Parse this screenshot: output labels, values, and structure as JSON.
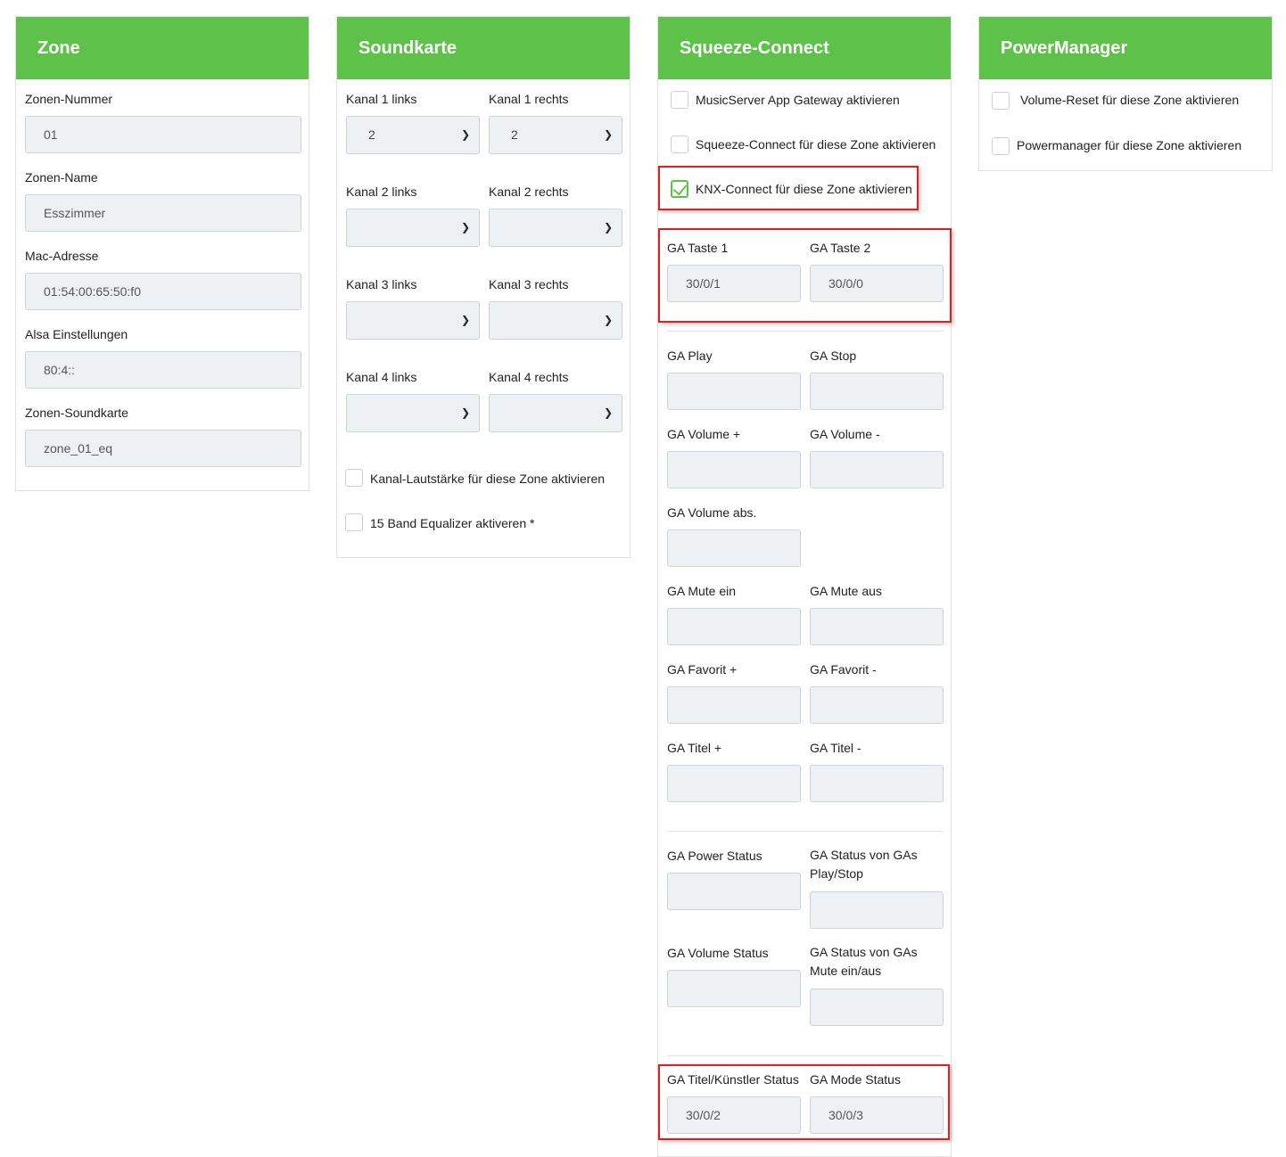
{
  "zone": {
    "title": "Zone",
    "fields": [
      {
        "label": "Zonen-Nummer",
        "value": "01"
      },
      {
        "label": "Zonen-Name",
        "value": "Esszimmer"
      },
      {
        "label": "Mac-Adresse",
        "value": "01:54:00:65:50:f0"
      },
      {
        "label": "Alsa Einstellungen",
        "value": "80:4::"
      },
      {
        "label": "Zonen-Soundkarte",
        "value": "zone_01_eq"
      }
    ]
  },
  "soundkarte": {
    "title": "Soundkarte",
    "channels": [
      {
        "left_label": "Kanal 1 links",
        "left_value": "2",
        "right_label": "Kanal 1 rechts",
        "right_value": "2"
      },
      {
        "left_label": "Kanal 2 links",
        "left_value": "",
        "right_label": "Kanal 2 rechts",
        "right_value": ""
      },
      {
        "left_label": "Kanal 3 links",
        "left_value": "",
        "right_label": "Kanal 3 rechts",
        "right_value": ""
      },
      {
        "left_label": "Kanal 4 links",
        "left_value": "",
        "right_label": "Kanal 4 rechts",
        "right_value": ""
      }
    ],
    "checkboxes": [
      {
        "label": "Kanal-Lautstärke für diese Zone aktivieren",
        "checked": false
      },
      {
        "label": "15 Band Equalizer aktiveren *",
        "checked": false
      }
    ]
  },
  "squeeze": {
    "title": "Squeeze-Connect",
    "checkboxes": [
      {
        "label": "MusicServer App Gateway aktivieren",
        "checked": false
      },
      {
        "label": "Squeeze-Connect für diese Zone aktivieren",
        "checked": false
      },
      {
        "label": "KNX-Connect für diese Zone aktivieren",
        "checked": true
      }
    ],
    "ga_taste1": {
      "label": "GA Taste 1",
      "value": "30/0/1"
    },
    "ga_taste2": {
      "label": "GA Taste 2",
      "value": "30/0/0"
    },
    "ga_play": {
      "label": "GA Play",
      "value": ""
    },
    "ga_stop": {
      "label": "GA Stop",
      "value": ""
    },
    "ga_vol_plus": {
      "label": "GA Volume +",
      "value": ""
    },
    "ga_vol_minus": {
      "label": "GA Volume -",
      "value": ""
    },
    "ga_vol_abs": {
      "label": "GA Volume abs.",
      "value": ""
    },
    "ga_mute_ein": {
      "label": "GA Mute ein",
      "value": ""
    },
    "ga_mute_aus": {
      "label": "GA Mute aus",
      "value": ""
    },
    "ga_fav_plus": {
      "label": "GA Favorit +",
      "value": ""
    },
    "ga_fav_minus": {
      "label": "GA Favorit -",
      "value": ""
    },
    "ga_titel_plus": {
      "label": "GA Titel +",
      "value": ""
    },
    "ga_titel_minus": {
      "label": "GA Titel -",
      "value": ""
    },
    "ga_power_status": {
      "label": "GA Power Status",
      "value": ""
    },
    "ga_status_playstop": {
      "label": "GA Status von GAs Play/Stop",
      "value": ""
    },
    "ga_volume_status": {
      "label": "GA Volume Status",
      "value": ""
    },
    "ga_status_mute": {
      "label": "GA Status von GAs Mute ein/aus",
      "value": ""
    },
    "ga_titel_kuenstler": {
      "label": "GA Titel/Künstler Status",
      "value": "30/0/2"
    },
    "ga_mode_status": {
      "label": "GA Mode Status",
      "value": "30/0/3"
    }
  },
  "powermanager": {
    "title": "PowerManager",
    "checkboxes": [
      {
        "label": "Volume-Reset für diese Zone aktivieren",
        "checked": false
      },
      {
        "label": "Powermanager für diese Zone aktivieren",
        "checked": false
      }
    ]
  },
  "colors": {
    "header_green": "#5ec14a",
    "highlight_red": "#e01e1e",
    "input_bg": "#eef1f4"
  },
  "icons": {
    "select_arrow": "chevron-down-icon",
    "check": "checkmark-icon"
  }
}
